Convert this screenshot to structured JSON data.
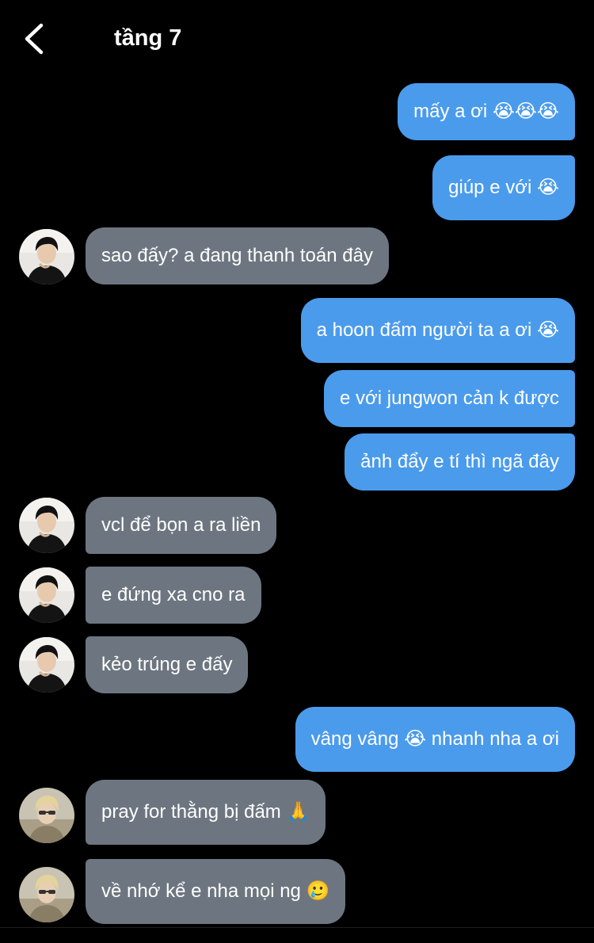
{
  "header": {
    "back_icon": "chevron-left-icon",
    "title": "tầng 7"
  },
  "messages": [
    {
      "side": "sent",
      "text": "mấy a ơi 😭😭😭"
    },
    {
      "side": "sent",
      "text": "giúp e với 😭"
    },
    {
      "side": "received",
      "avatar": "avatar-dark-hair",
      "text": "sao đấy? a đang thanh toán đây"
    },
    {
      "side": "sent",
      "text": "a hoon đấm người ta a ơi 😭"
    },
    {
      "side": "sent",
      "text": "e với jungwon cản k được"
    },
    {
      "side": "sent",
      "text": "ảnh đẩy e tí thì ngã đây"
    },
    {
      "side": "received",
      "avatar": "avatar-dark-hair",
      "text": "vcl để bọn a ra liền"
    },
    {
      "side": "received",
      "avatar": "avatar-dark-hair",
      "text": "e đứng xa cno ra"
    },
    {
      "side": "received",
      "avatar": "avatar-dark-hair",
      "text": "kẻo trúng e đấy"
    },
    {
      "side": "sent",
      "text": "vâng vâng 😭 nhanh nha a ơi"
    },
    {
      "side": "received",
      "avatar": "avatar-blond-hair",
      "text": "pray for thằng bị đấm 🙏"
    },
    {
      "side": "received",
      "avatar": "avatar-blond-hair",
      "text": "về nhớ kể e nha mọi ng 🥲"
    }
  ],
  "colors": {
    "background": "#000000",
    "sent_bubble": "#4a9bec",
    "received_bubble": "#6d7680",
    "text": "#ffffff"
  }
}
